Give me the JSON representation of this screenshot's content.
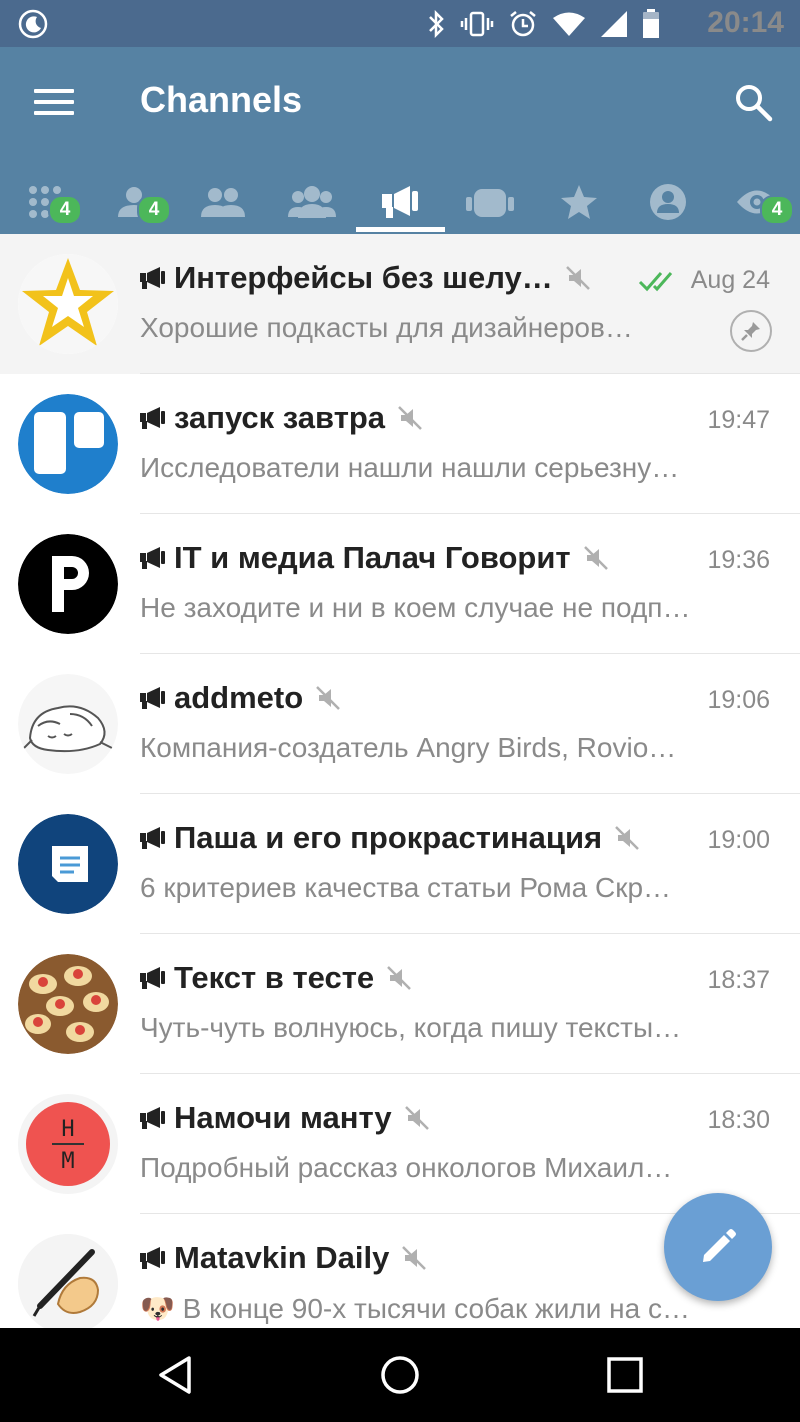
{
  "status_bar": {
    "time": "20:14",
    "icons": [
      "moon-icon",
      "bluetooth-icon",
      "vibrate-icon",
      "alarm-icon",
      "wifi-icon",
      "signal-icon",
      "battery-icon"
    ]
  },
  "header": {
    "title": "Channels",
    "menu_icon": "hamburger-icon",
    "search_icon": "search-icon"
  },
  "tabs": [
    {
      "id": "all",
      "icon": "grid-icon",
      "badge": "4",
      "active": false
    },
    {
      "id": "contacts",
      "icon": "person-icon",
      "badge": "4",
      "active": false
    },
    {
      "id": "groups",
      "icon": "group-icon",
      "badge": "",
      "active": false
    },
    {
      "id": "supergroups",
      "icon": "supergroup-icon",
      "badge": "",
      "active": false
    },
    {
      "id": "channels",
      "icon": "megaphone-icon",
      "badge": "",
      "active": true
    },
    {
      "id": "bots",
      "icon": "bot-icon",
      "badge": "",
      "active": false
    },
    {
      "id": "favorites",
      "icon": "star-icon",
      "badge": "",
      "active": false
    },
    {
      "id": "admin",
      "icon": "admin-icon",
      "badge": "",
      "active": false
    },
    {
      "id": "unread",
      "icon": "eye-icon",
      "badge": "4",
      "active": false
    }
  ],
  "chats": [
    {
      "name": "Интерфейсы без шелу…",
      "time": "Aug 24",
      "message": "Хорошие подкасты для дизайнеров…",
      "pinned": true,
      "read": true
    },
    {
      "name": "запуск завтра",
      "time": "19:47",
      "message": "Исследователи нашли нашли серьезну…"
    },
    {
      "name": "IT и медиа Палач Говорит",
      "time": "19:36",
      "message": "Не заходите и ни в коем случае не подп…"
    },
    {
      "name": "addmeto",
      "time": "19:06",
      "message": "Компания-создатель Angry Birds, Rovio…"
    },
    {
      "name": "Паша и его прокрастинация",
      "time": "19:00",
      "message": "6 критериев качества статьи  Рома Скр…"
    },
    {
      "name": "Текст в тесте",
      "time": "18:37",
      "message": "Чуть-чуть волнуюсь, когда пишу тексты…"
    },
    {
      "name": "Намочи манту",
      "time": "18:30",
      "message": "Подробный рассказ онкологов Михаил…"
    },
    {
      "name": "Matavkin Daily",
      "time": "",
      "message": "🐶 В конце 90-х тысячи собак жили на с…"
    }
  ],
  "avatar_monogram": {
    "top": "Н",
    "bottom": "М"
  },
  "colors": {
    "status_bar": "#4b6a8e",
    "app_bar": "#5682a3",
    "badge": "#4cb75a",
    "fab": "#6a9fd4",
    "read_check": "#4cb75a"
  }
}
